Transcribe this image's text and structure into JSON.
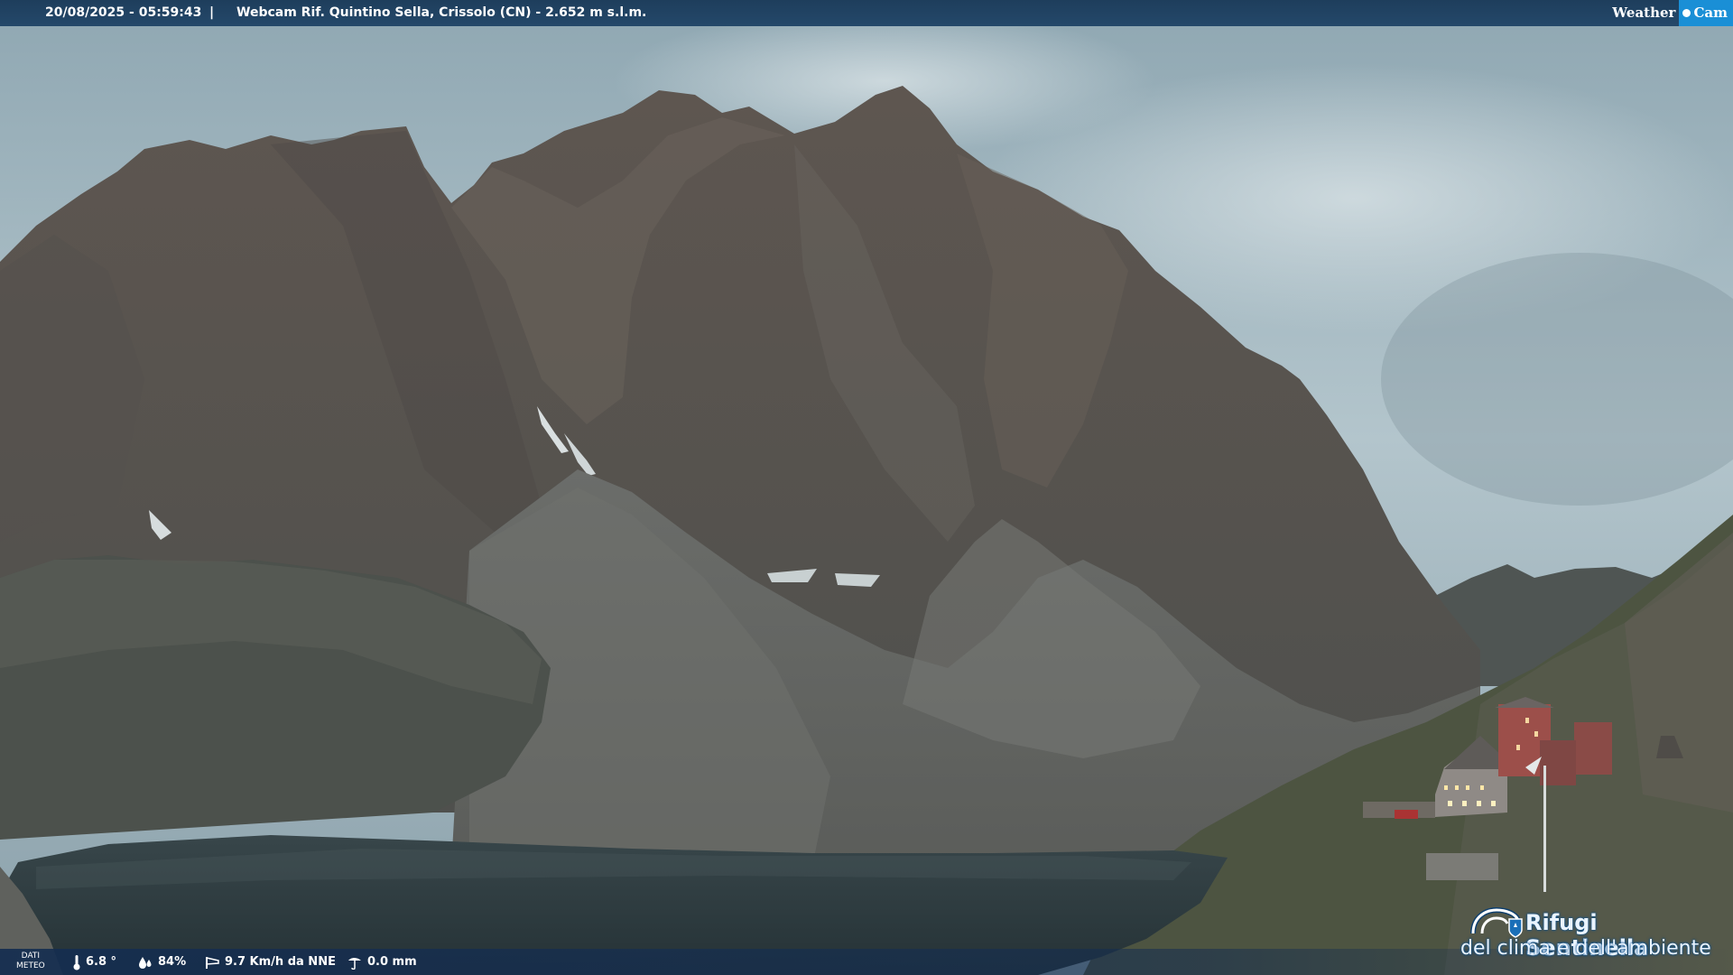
{
  "header": {
    "timestamp": "20/08/2025 - 05:59:43",
    "separator": "|",
    "camera_title": "Webcam Rif. Quintino Sella, Crissolo (CN) - 2.652 m s.l.m.",
    "logo_weather": "Weather",
    "logo_cam": "Cam"
  },
  "footer": {
    "dati_label_line1": "DATI",
    "dati_label_line2": "METEO",
    "temperature": "6.8 °",
    "humidity": "84%",
    "wind": "9.7 Km/h da NNE",
    "rain": "0.0 mm"
  },
  "branding": {
    "line1": "Rifugi Sentinella",
    "line2": "del clima e dell'ambiente"
  },
  "colors": {
    "bar": "#24486a",
    "logo_blue": "#1a8fd6",
    "sky": "#a9bcc4",
    "rock": "#5d5c58",
    "lake": "#2f3c40"
  },
  "icons": {
    "temperature": "thermometer-icon",
    "humidity": "droplets-icon",
    "wind": "wind-sock-icon",
    "rain": "rain-gauge-icon"
  }
}
